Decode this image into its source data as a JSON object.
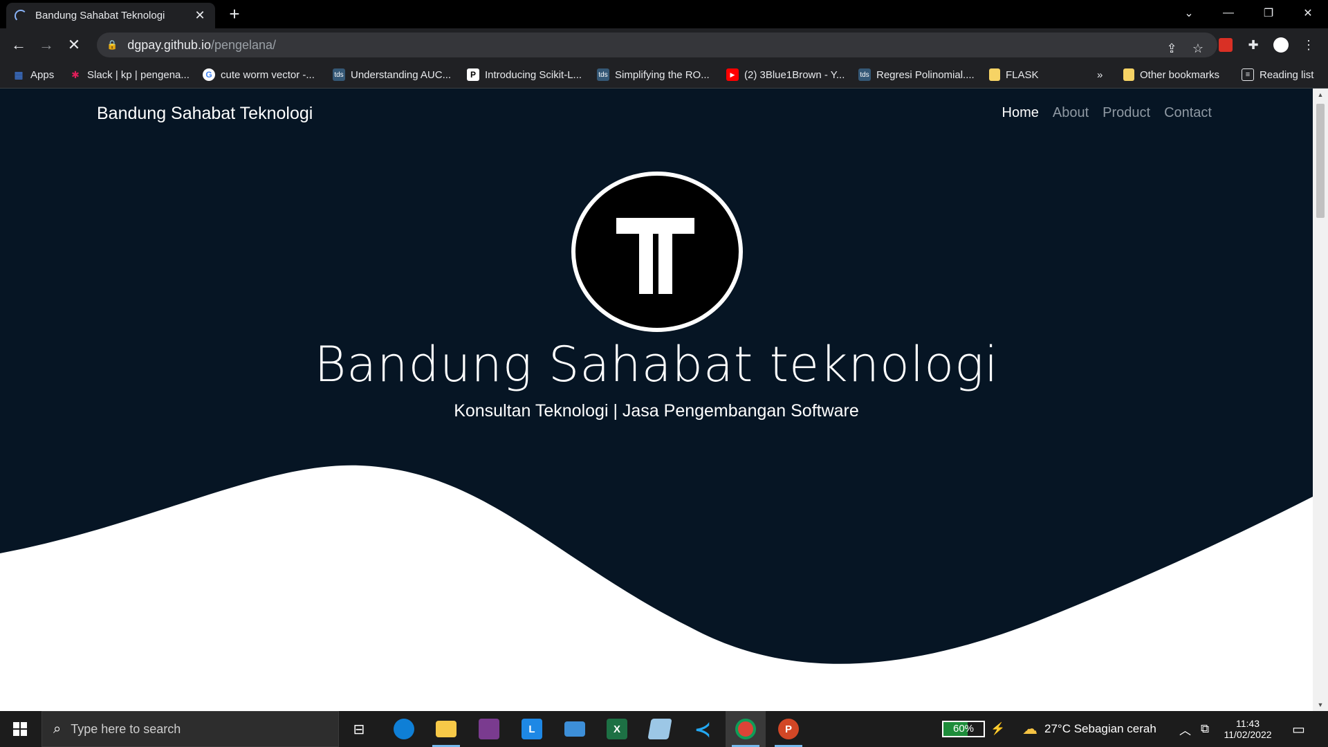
{
  "browser": {
    "tab_title": "Bandung Sahabat Teknologi",
    "url_host": "dgpay.github.io",
    "url_path": "/pengelana/",
    "bookmarks": [
      {
        "label": "Apps",
        "icon": "apps-grid-icon"
      },
      {
        "label": "Slack | kp | pengena...",
        "icon": "slack-icon"
      },
      {
        "label": "cute worm vector -...",
        "icon": "google-icon"
      },
      {
        "label": "Understanding AUC...",
        "icon": "tds-icon"
      },
      {
        "label": "Introducing Scikit-L...",
        "icon": "p-icon"
      },
      {
        "label": "Simplifying the RO...",
        "icon": "tds-icon"
      },
      {
        "label": "(2) 3Blue1Brown - Y...",
        "icon": "youtube-icon"
      },
      {
        "label": "Regresi Polinomial....",
        "icon": "tds-icon"
      },
      {
        "label": "FLASK",
        "icon": "folder-icon"
      }
    ],
    "overflow": "»",
    "other_bookmarks": "Other bookmarks",
    "reading_list": "Reading list"
  },
  "site": {
    "brand": "Bandung Sahabat Teknologi",
    "nav": [
      {
        "label": "Home",
        "active": true
      },
      {
        "label": "About",
        "active": false
      },
      {
        "label": "Product",
        "active": false
      },
      {
        "label": "Contact",
        "active": false
      }
    ],
    "hero_title": "Bandung Sahabat teknologi",
    "hero_subtitle": "Konsultan Teknologi | Jasa Pengembangan Software",
    "colors": {
      "background": "#061524",
      "wave": "#ffffff"
    }
  },
  "taskbar": {
    "search_placeholder": "Type here to search",
    "battery": "60%",
    "battery_level": 0.6,
    "weather": "27°C  Sebagian cerah",
    "time": "11:43",
    "date": "11/02/2022"
  }
}
